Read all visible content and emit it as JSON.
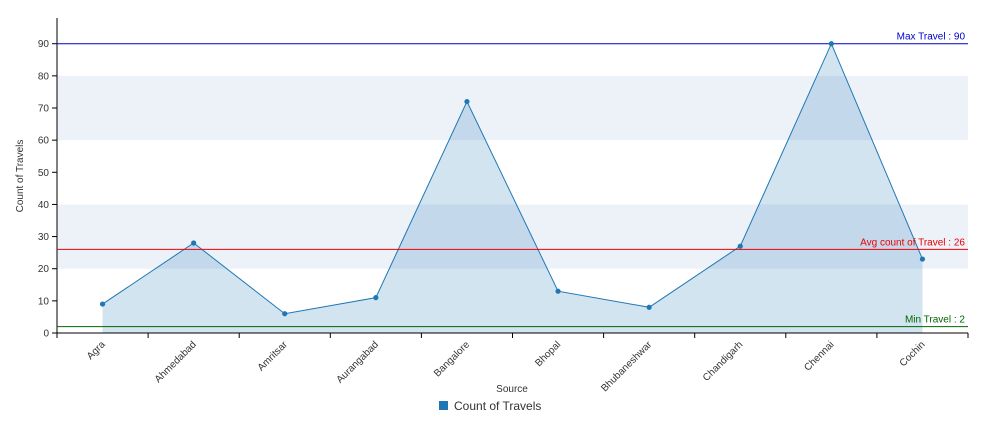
{
  "chart_data": {
    "type": "area",
    "categories": [
      "Agra",
      "Ahmedabad",
      "Amritsar",
      "Aurangabad",
      "Bangalore",
      "Bhopal",
      "Bhubaneshwar",
      "Chandigarh",
      "Chennai",
      "Cochin"
    ],
    "series": [
      {
        "name": "Count of Travels",
        "values": [
          9,
          28,
          6,
          11,
          72,
          13,
          8,
          27,
          90,
          23
        ],
        "color": "#1f77b4"
      }
    ],
    "xlabel": "Source",
    "ylabel": "Count of Travels",
    "ylim": [
      0,
      98
    ],
    "yticks": [
      0,
      10,
      20,
      30,
      40,
      50,
      60,
      70,
      80,
      90
    ],
    "grid": "alternating horizontal bands",
    "band_color": "#edf2f9",
    "reference_lines": [
      {
        "label": "Max Travel : 90",
        "value": 90,
        "color": "#0000cc"
      },
      {
        "label": "Avg count of Travel : 26",
        "value": 26,
        "color": "#ee0000"
      },
      {
        "label": "Min Travel : 2",
        "value": 2,
        "color": "#006600"
      }
    ],
    "legend": {
      "position": "bottom-center",
      "label": "Count of Travels"
    }
  }
}
